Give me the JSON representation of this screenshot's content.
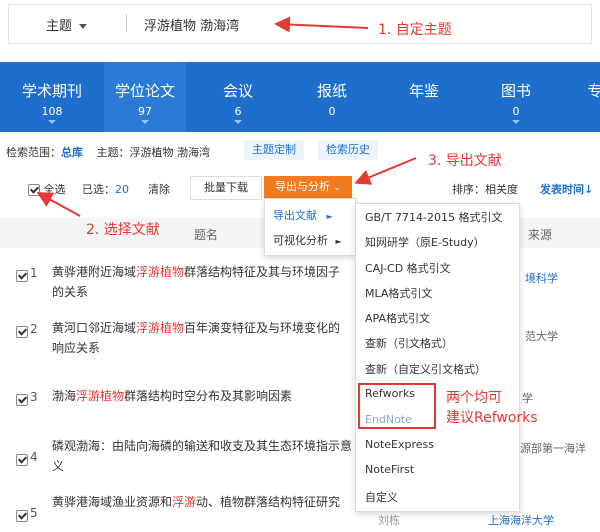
{
  "search": {
    "subject_label": "主题",
    "query": "浮游植物 渤海湾"
  },
  "tabs": [
    {
      "label": "学术期刊",
      "count": "108"
    },
    {
      "label": "学位论文",
      "count": "97"
    },
    {
      "label": "会议",
      "count": "6"
    },
    {
      "label": "报纸",
      "count": "0"
    },
    {
      "label": "年鉴",
      "count": ""
    },
    {
      "label": "图书",
      "count": "0"
    },
    {
      "label": "专",
      "count": ""
    }
  ],
  "scope": {
    "prefix": "检索范围：",
    "db": "总库",
    "topic_label": "主题：",
    "topic_value": "浮游植物 渤海湾",
    "custom_btn": "主题定制",
    "history_btn": "检索历史"
  },
  "toolbar": {
    "select_all": "全选",
    "selected_label": "已选：",
    "selected_count": "20",
    "clear": "清除",
    "batch_download": "批量下载",
    "export_analyze": "导出与分析",
    "sort_label": "排序：",
    "sort_relevance": "相关度",
    "sort_date": "发表时间"
  },
  "table": {
    "col_title": "题名",
    "col_source": "来源"
  },
  "rows": [
    {
      "num": "1",
      "title_pre": "黄骅港附近海域",
      "title_hl": "浮游植物",
      "title_post": "群落结构特征及其与环境因子的关系",
      "source": "境科学",
      "author": ""
    },
    {
      "num": "2",
      "title_pre": "黄河口邻近海域",
      "title_hl": "浮游植物",
      "title_post": "百年演变特征及与环境变化的响应关系",
      "source": "范大学",
      "author": ""
    },
    {
      "num": "3",
      "title_pre": "渤海",
      "title_hl": "浮游植物",
      "title_post": "群落结构时空分布及其影响因素",
      "source": "学",
      "author": ""
    },
    {
      "num": "4",
      "title_pre": "磷观渤海：由陆向海磷的输送和收支及其生态环境指示意义",
      "title_hl": "",
      "title_post": "",
      "source": "源部第一海洋",
      "author": ""
    },
    {
      "num": "5",
      "title_pre": "黄骅港海域渔业资源和",
      "title_hl": "浮游",
      "title_post": "动、植物群落结构特征研究",
      "source": "上海海洋大学",
      "author": "刘栋"
    }
  ],
  "menu1": {
    "export_doc": "导出文献",
    "visual_analysis": "可视化分析"
  },
  "menu2": [
    "GB/T 7714-2015 格式引文",
    "知网研学（原E-Study）",
    "CAJ-CD 格式引文",
    "MLA格式引文",
    "APA格式引文",
    "查新（引文格式）",
    "查新（自定义引文格式）",
    "Refworks",
    "EndNote",
    "NoteExpress",
    "NoteFirst",
    "自定义"
  ],
  "annotations": {
    "a1": "1. 自定主题",
    "a2": "2. 选择文献",
    "a3": "3. 导出文献",
    "a4_line1": "两个均可",
    "a4_line2": "建议Refworks"
  }
}
